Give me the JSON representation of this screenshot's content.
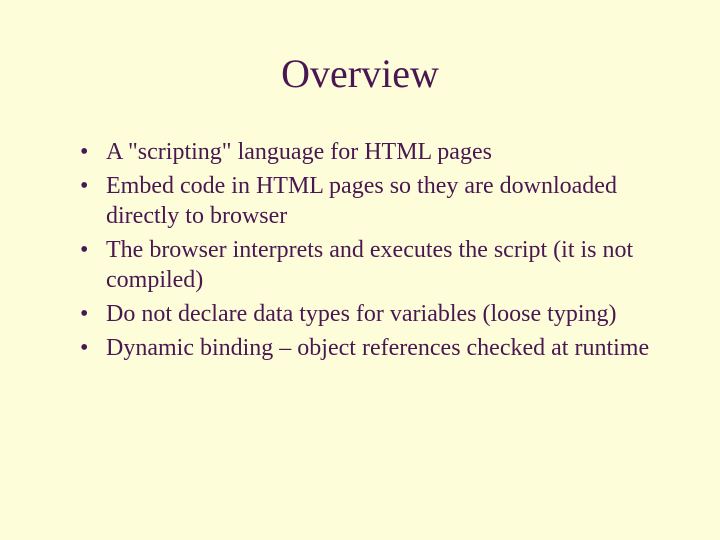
{
  "slide": {
    "title": "Overview",
    "bullets": [
      "A \"scripting\" language for HTML pages",
      "Embed code in HTML pages so they are downloaded directly to browser",
      "The browser interprets and executes the script (it is not compiled)",
      "Do not declare data types for variables (loose typing)",
      "Dynamic binding – object references checked at runtime"
    ]
  }
}
